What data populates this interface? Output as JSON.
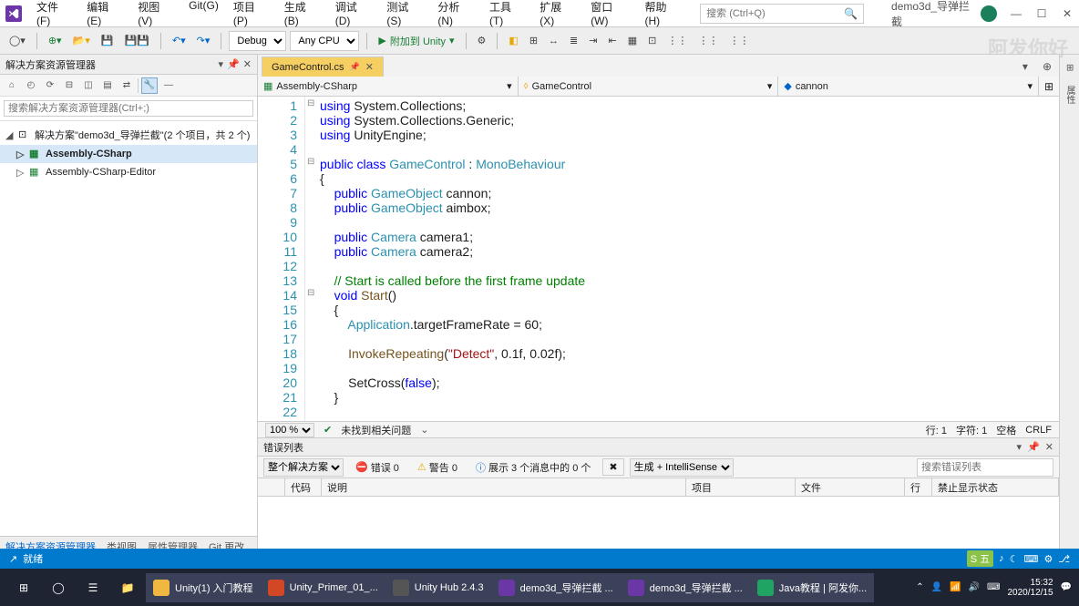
{
  "menubar": {
    "items": [
      "文件(F)",
      "编辑(E)",
      "视图(V)",
      "Git(G)",
      "项目(P)",
      "生成(B)",
      "调试(D)",
      "测试(S)",
      "分析(N)",
      "工具(T)",
      "扩展(X)",
      "窗口(W)",
      "帮助(H)"
    ],
    "search_placeholder": "搜索 (Ctrl+Q)",
    "title": "demo3d_导弹拦截"
  },
  "toolbar": {
    "config": "Debug",
    "platform": "Any CPU",
    "run_label": "附加到 Unity"
  },
  "solution_explorer": {
    "title": "解决方案资源管理器",
    "search_placeholder": "搜索解决方案资源管理器(Ctrl+;)",
    "root": "解决方案\"demo3d_导弹拦截\"(2 个项目，共 2 个)",
    "proj1": "Assembly-CSharp",
    "proj2": "Assembly-CSharp-Editor",
    "tabs": [
      "解决方案资源管理器",
      "类视图",
      "属性管理器",
      "Git 更改"
    ]
  },
  "editor": {
    "file_tab": "GameControl.cs",
    "nav1": "Assembly-CSharp",
    "nav2": "GameControl",
    "nav3": "cannon",
    "zoom": "100 %",
    "issues_label": "未找到相关问题",
    "status_line": "行: 1",
    "status_char": "字符: 1",
    "status_space": "空格",
    "status_crlf": "CRLF"
  },
  "code_lines": [
    {
      "n": 1,
      "k": "using",
      "rest": " System.Collections;"
    },
    {
      "n": 2,
      "k": "using",
      "rest": " System.Collections.Generic;"
    },
    {
      "n": 3,
      "k": "using",
      "rest": " UnityEngine;"
    },
    {
      "n": 4,
      "plain": ""
    },
    {
      "n": 5,
      "html": "<span class='kw'>public class</span> <span class='type'>GameControl</span> : <span class='type'>MonoBehaviour</span>"
    },
    {
      "n": 6,
      "plain": "{"
    },
    {
      "n": 7,
      "html": "    <span class='kw'>public</span> <span class='type'>GameObject</span> cannon;"
    },
    {
      "n": 8,
      "html": "    <span class='kw'>public</span> <span class='type'>GameObject</span> aimbox;"
    },
    {
      "n": 9,
      "plain": ""
    },
    {
      "n": 10,
      "html": "    <span class='kw'>public</span> <span class='type'>Camera</span> camera1;"
    },
    {
      "n": 11,
      "html": "    <span class='kw'>public</span> <span class='type'>Camera</span> camera2;"
    },
    {
      "n": 12,
      "plain": ""
    },
    {
      "n": 13,
      "html": "    <span class='com'>// Start is called before the first frame update</span>"
    },
    {
      "n": 14,
      "html": "    <span class='kw'>void</span> <span class='meth'>Start</span>()"
    },
    {
      "n": 15,
      "plain": "    {"
    },
    {
      "n": 16,
      "html": "        <span class='type'>Application</span>.targetFrameRate = 60;"
    },
    {
      "n": 17,
      "plain": ""
    },
    {
      "n": 18,
      "html": "        <span class='meth'>InvokeRepeating</span>(<span class='str'>\"Detect\"</span>, 0.1f, 0.02f);"
    },
    {
      "n": 19,
      "plain": ""
    },
    {
      "n": 20,
      "html": "        SetCross(<span class='kw'>false</span>);"
    },
    {
      "n": 21,
      "plain": "    }"
    },
    {
      "n": 22,
      "plain": ""
    }
  ],
  "error_list": {
    "title": "错误列表",
    "scope": "整个解决方案",
    "errors": "错误 0",
    "warnings": "警告 0",
    "messages": "展示 3 个消息中的 0 个",
    "build_scope": "生成 + IntelliSense",
    "search_placeholder": "搜索错误列表",
    "cols": [
      "",
      "代码",
      "说明",
      "项目",
      "文件",
      "行",
      "禁止显示状态"
    ]
  },
  "status_bar": {
    "text": "就绪"
  },
  "taskbar": {
    "items": [
      {
        "label": "Unity(1) 入门教程",
        "color": "#f0b840"
      },
      {
        "label": "Unity_Primer_01_...",
        "color": "#d24726"
      },
      {
        "label": "Unity Hub 2.4.3",
        "color": "#555"
      },
      {
        "label": "demo3d_导弹拦截 ...",
        "color": "#6b37a6"
      },
      {
        "label": "demo3d_导弹拦截 ...",
        "color": "#6b37a6"
      },
      {
        "label": "Java教程 | 阿发你...",
        "color": "#1fa463"
      }
    ],
    "time": "15:32",
    "date": "2020/12/15"
  },
  "watermark": "阿发你好"
}
